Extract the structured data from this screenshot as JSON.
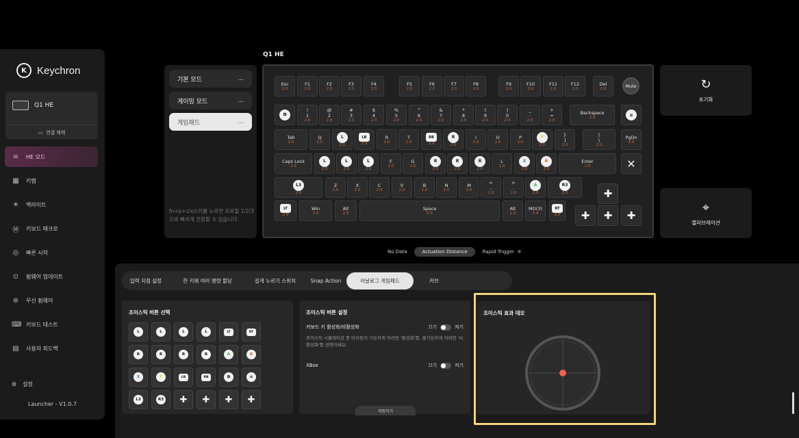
{
  "brand": {
    "name": "Keychron",
    "logo_letter": "K"
  },
  "device": {
    "name": "Q1 HE",
    "disconnect_label": "연결 해제"
  },
  "nav": [
    {
      "icon": "he-mode-icon",
      "glyph": "≡",
      "label": "HE 모드",
      "active": true
    },
    {
      "icon": "keymap-icon",
      "glyph": "▦",
      "label": "키맵"
    },
    {
      "icon": "backlight-icon",
      "glyph": "☀",
      "label": "백라이트"
    },
    {
      "icon": "macro-icon",
      "glyph": "Ⓜ",
      "label": "키보드 매크로"
    },
    {
      "icon": "quick-start-icon",
      "glyph": "◎",
      "label": "빠른 시작"
    },
    {
      "icon": "firmware-update-icon",
      "glyph": "⊙",
      "label": "펌웨어 업데이트"
    },
    {
      "icon": "wireless-firmware-icon",
      "glyph": "⊛",
      "label": "무선 펌웨어"
    },
    {
      "icon": "keyboard-test-icon",
      "glyph": "⌨",
      "label": "키보드 테스트"
    },
    {
      "icon": "feedback-icon",
      "glyph": "▤",
      "label": "사용자 피드백"
    }
  ],
  "settings_label": "설정",
  "version": "Launcher - V1.0.7",
  "modes": {
    "items": [
      {
        "label": "기본 모드",
        "more": "..."
      },
      {
        "label": "게이밍 모드",
        "more": "..."
      },
      {
        "label": "게임패드",
        "more": "...",
        "active": true
      }
    ],
    "note": "fn+p+z/x/c키를 누르면 프로필 1/2/3으로 빠르게 전환할 수 있습니다."
  },
  "keyboard": {
    "title": "Q1 HE",
    "default_value": "2.0",
    "rows": [
      [
        [
          "Esc",
          ""
        ],
        [
          "F1",
          ""
        ],
        [
          "F2",
          ""
        ],
        [
          "F3",
          ""
        ],
        [
          "F4",
          ""
        ],
        [
          "F5",
          ""
        ],
        [
          "F6",
          ""
        ],
        [
          "F7",
          ""
        ],
        [
          "F8",
          ""
        ],
        [
          "F9",
          ""
        ],
        [
          "F10",
          ""
        ],
        [
          "F11",
          ""
        ],
        [
          "F12",
          ""
        ],
        [
          "Del",
          ""
        ]
      ],
      [
        [
          "icon:copy",
          ""
        ],
        [
          "!",
          "1"
        ],
        [
          "@",
          "2"
        ],
        [
          "#",
          "3"
        ],
        [
          "$",
          "4"
        ],
        [
          "%",
          "5"
        ],
        [
          "^",
          "6"
        ],
        [
          "&",
          "7"
        ],
        [
          "*",
          "8"
        ],
        [
          "(",
          "9"
        ],
        [
          ")",
          "0"
        ],
        [
          "_",
          "-"
        ],
        [
          "+",
          "="
        ],
        [
          "Backspace",
          ""
        ],
        [
          "icon:menu",
          ""
        ]
      ],
      [
        [
          "Tab",
          ""
        ],
        [
          "Q",
          ""
        ],
        [
          "gp:L",
          ""
        ],
        [
          "sq:LB",
          ""
        ],
        [
          "R",
          ""
        ],
        [
          "T",
          ""
        ],
        [
          "sq:RB",
          ""
        ],
        [
          "gp:R",
          ""
        ],
        [
          "I",
          ""
        ],
        [
          "O",
          ""
        ],
        [
          "P",
          ""
        ],
        [
          "gy:Y",
          ""
        ],
        [
          "}",
          "]"
        ],
        [
          "|",
          "\\"
        ],
        [
          "PgDn",
          ""
        ]
      ],
      [
        [
          "Caps Lock",
          ""
        ],
        [
          "gp:L",
          ""
        ],
        [
          "gp:L",
          ""
        ],
        [
          "gp:L",
          ""
        ],
        [
          "F",
          ""
        ],
        [
          "G",
          ""
        ],
        [
          "gp:R",
          ""
        ],
        [
          "gp:R",
          ""
        ],
        [
          "gp:R",
          ""
        ],
        [
          "L",
          ""
        ],
        [
          "gb:X",
          ""
        ],
        [
          "go:B",
          ""
        ],
        [
          "Enter",
          ""
        ],
        [
          "icon:x",
          ""
        ]
      ],
      [
        [
          "gp:L3",
          ""
        ],
        [
          "Z",
          ""
        ],
        [
          "X",
          ""
        ],
        [
          "C",
          ""
        ],
        [
          "V",
          ""
        ],
        [
          "B",
          ""
        ],
        [
          "N",
          ""
        ],
        [
          "M",
          ""
        ],
        [
          "<",
          ","
        ],
        [
          ">",
          "."
        ],
        [
          "gg:A",
          ""
        ],
        [
          "gp:R3",
          ""
        ],
        [
          "plus",
          ""
        ]
      ],
      [
        [
          "sq:LT",
          ""
        ],
        [
          "Win",
          ""
        ],
        [
          "Alt",
          ""
        ],
        [
          "Space",
          ""
        ],
        [
          "Alt",
          ""
        ],
        [
          "MO(3)",
          ""
        ],
        [
          "sq:RT",
          ""
        ],
        [
          "plus",
          ""
        ],
        [
          "plus",
          ""
        ],
        [
          "plus",
          ""
        ]
      ]
    ],
    "mute_label": "Mute"
  },
  "right": {
    "reset_label": "초기화",
    "calibrate_label": "캘리브레이션"
  },
  "segment": {
    "items": [
      "No Data",
      "Actuation Distance",
      "Rapid Trigger"
    ],
    "active": 1
  },
  "tabs": {
    "items": [
      "입력 지점 설정",
      "한 키에 여러 명령 할당",
      "길게 누르기 스위치",
      "Snap Action",
      "아날로그 게임패드",
      "커브"
    ],
    "active": 4
  },
  "joystick_buttons": {
    "title": "조이스틱 버튼 선택",
    "items": [
      "gp:L",
      "gp:L",
      "gp:L",
      "gp:L",
      "sq:LT",
      "sq:RT",
      "gp:R",
      "gp:R",
      "gp:R",
      "gp:R",
      "gg:A",
      "go:B",
      "gb:X",
      "gy:Y",
      "sq:LB",
      "sq:RB",
      "icon:copy",
      "icon:menu",
      "gp:L3",
      "gp:R3",
      "plus",
      "plus",
      "plus",
      "plus"
    ]
  },
  "joystick_settings": {
    "title": "조이스틱 버튼 설정",
    "row1_label": "키보드 키 활성화/비활성화",
    "off": "끄기",
    "on": "켜기",
    "description": "조이스틱 시뮬레이션 중 타이핑이 가능하게 하려면 '활성화'를, 불가능하게 하려면 '비활성화'를 선택하세요.",
    "row2_label": "XBox",
    "save_label": "저장하기"
  },
  "demo": {
    "title": "조이스틱 효과 데모",
    "dot_color": "#f0604a"
  }
}
